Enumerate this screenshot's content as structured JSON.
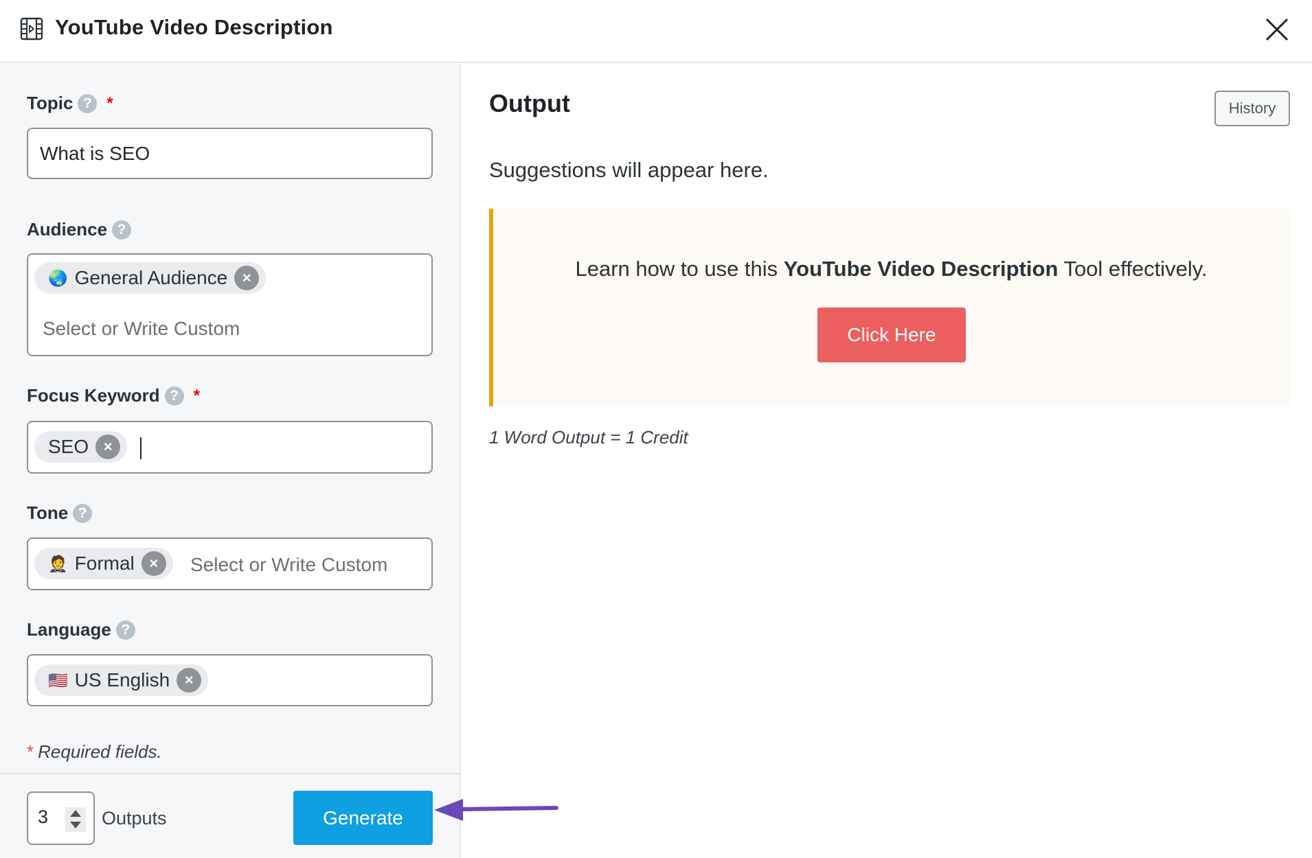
{
  "header": {
    "title": "YouTube Video Description",
    "icon": "film-icon",
    "close_icon": "close-icon"
  },
  "form": {
    "topic": {
      "label": "Topic",
      "help": "?",
      "required_mark": "*",
      "value": "What is SEO"
    },
    "audience": {
      "label": "Audience",
      "help": "?",
      "chips": [
        {
          "emoji": "🌏",
          "label": "General Audience",
          "remove": "×"
        }
      ],
      "placeholder": "Select or Write Custom"
    },
    "focus_keyword": {
      "label": "Focus Keyword",
      "help": "?",
      "required_mark": "*",
      "chips": [
        {
          "label": "SEO",
          "remove": "×"
        }
      ],
      "value": ""
    },
    "tone": {
      "label": "Tone",
      "help": "?",
      "chips": [
        {
          "emoji": "🤵",
          "label": "Formal",
          "remove": "×"
        }
      ],
      "placeholder": "Select or Write Custom"
    },
    "language": {
      "label": "Language",
      "help": "?",
      "chips": [
        {
          "emoji": "🇺🇸",
          "label": "US English",
          "remove": "×"
        }
      ]
    },
    "required_note_star": "*",
    "required_note": "Required fields."
  },
  "footer": {
    "outputs_value": "3",
    "outputs_label": "Outputs",
    "generate_label": "Generate"
  },
  "output": {
    "title": "Output",
    "history_label": "History",
    "suggestions": "Suggestions will appear here.",
    "callout": {
      "prefix": "Learn how to use this ",
      "bold": "YouTube Video Description",
      "suffix": " Tool effectively.",
      "button_label": "Click Here"
    },
    "credit_note": "1 Word Output = 1 Credit"
  },
  "annotation": {
    "arrow_color": "#6b48b8",
    "points_to": "generate-button"
  },
  "colors": {
    "generate": "#0ea0e0",
    "click_here": "#ec5f5f",
    "callout_border": "#eaa20e",
    "callout_bg": "#fdf9f4",
    "required": "#e00000"
  }
}
